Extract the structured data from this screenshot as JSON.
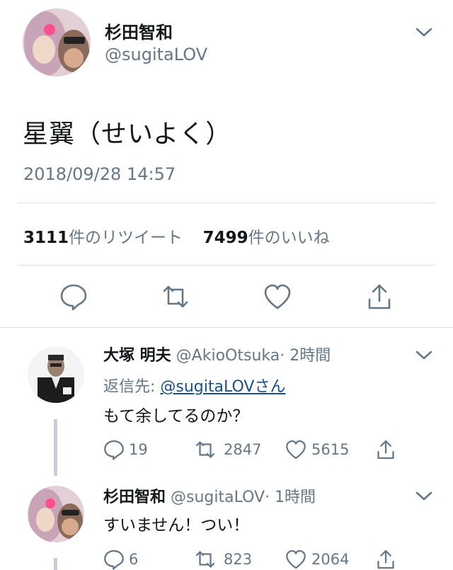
{
  "main_tweet": {
    "display_name": "杉田智和",
    "handle": "@sugitaLOV",
    "text": "星翼（せいよく）",
    "timestamp": "2018/09/28 14:57",
    "retweets": {
      "count": "3111",
      "label": "件のリツイート"
    },
    "likes": {
      "count": "7499",
      "label": "件のいいね"
    }
  },
  "replies": [
    {
      "display_name": "大塚 明夫",
      "handle": "@AkioOtsuka",
      "time": "· 2時間",
      "reply_to_prefix": "返信先: ",
      "reply_to_handle": "@sugitaLOVさん",
      "text": "もて余してるのか？",
      "reply_count": "19",
      "retweet_count": "2847",
      "like_count": "5615"
    },
    {
      "display_name": "杉田智和",
      "handle": "@sugitaLOV",
      "time": "· 1時間",
      "text": "すいません！つい！",
      "reply_count": "6",
      "retweet_count": "823",
      "like_count": "2064"
    }
  ],
  "colors": {
    "text": "#14171a",
    "secondary": "#657786",
    "link": "#1b4f8a",
    "divider": "#d8dee3"
  }
}
